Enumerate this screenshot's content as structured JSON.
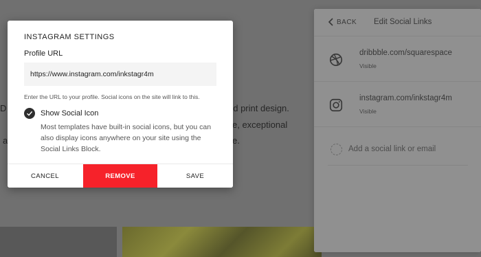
{
  "background": {
    "line1_left": "D",
    "line1_right": "nd print design.",
    "line2_right": "e, exceptional",
    "line3_left": "a",
    "line3_right": "e."
  },
  "modal": {
    "title": "INSTAGRAM SETTINGS",
    "field_label": "Profile URL",
    "url_value": "https://www.instagram.com/inkstagr4m",
    "helper_text": "Enter the URL to your profile. Social icons on the site will link to this.",
    "checkbox_label": "Show Social Icon",
    "checkbox_checked": true,
    "checkbox_description": "Most templates have built-in social icons, but you can also display icons anywhere on your site using the Social Links Block.",
    "cancel_label": "CANCEL",
    "remove_label": "REMOVE",
    "save_label": "SAVE"
  },
  "panel": {
    "back_label": "BACK",
    "title": "Edit Social Links",
    "links": [
      {
        "icon": "dribbble-icon",
        "url": "dribbble.com/squarespace",
        "status": "Visible"
      },
      {
        "icon": "instagram-icon",
        "url": "instagram.com/inkstagr4m",
        "status": "Visible"
      }
    ],
    "add_label": "Add a social link or email"
  },
  "colors": {
    "remove_button": "#f6222a",
    "overlay": "#707070",
    "checkbox": "#2e2e2e"
  }
}
